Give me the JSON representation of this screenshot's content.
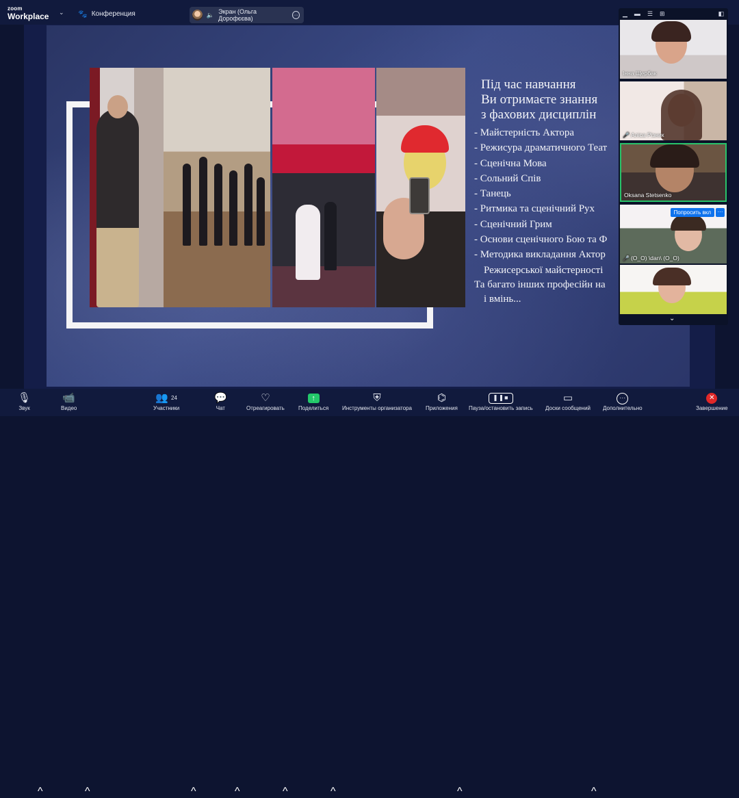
{
  "app": {
    "logo_top": "zoom",
    "logo_bottom": "Workplace",
    "meeting_title": "Конференция"
  },
  "share_indicator": {
    "label": "Экран (Ольга Дорофєєва)"
  },
  "slide": {
    "heading_lines": [
      "Під час навчання",
      "Ви отримаєте знання",
      "з фахових дисциплін"
    ],
    "items": [
      "- Майстерність Актора",
      "- Режисура драматичного Теат",
      "- Сценічна Мова",
      "- Сольний Спів",
      "- Танець",
      "- Ритмика та сценічний Рух",
      "- Сценічний Грим",
      "- Основи сценічного Бою та Ф",
      "- Методика викладання Актор",
      "Режисерської майстерності"
    ],
    "footer_lines": [
      "Та багато інших професійн на",
      "і вмінь..."
    ]
  },
  "participants": [
    {
      "name": "Інна Щербак",
      "muted": false
    },
    {
      "name": "Аліса Різник",
      "muted": true
    },
    {
      "name": "Oksana Stetsenko",
      "muted": false,
      "active_speaker": true
    },
    {
      "name": "(O_O) \\dan\\ (O_O)",
      "muted": true
    },
    {
      "name": "",
      "muted": false
    }
  ],
  "ask_unmute_label": "Попросить вкл",
  "ask_more_label": "···",
  "toolbar": {
    "audio": "Звук",
    "video": "Видео",
    "participants": "Участники",
    "participants_count": "24",
    "chat": "Чат",
    "react": "Отреагировать",
    "share": "Поделиться",
    "host_tools": "Инструменты организатора",
    "apps": "Приложения",
    "pause_share": "Пауза/остановить запись",
    "whiteboards": "Доски сообщений",
    "more": "Дополнительно",
    "end": "Завершение"
  }
}
